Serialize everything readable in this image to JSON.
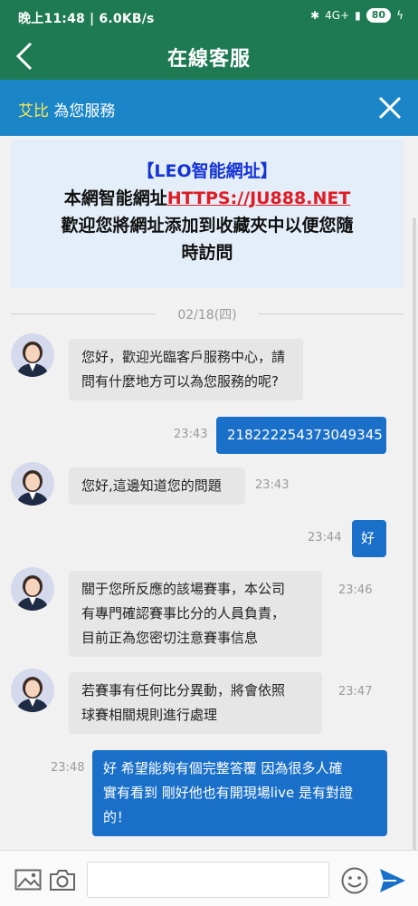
{
  "status_bar": {
    "left": "晚上11:48 | 6.0KB/s",
    "network": "4G+",
    "battery": "80"
  },
  "header": {
    "title": "在線客服"
  },
  "agent_bar": {
    "name": "艾比",
    "suffix": " 為您服務"
  },
  "notice": {
    "line1": "【LEO智能網址】",
    "line2_prefix": "本網智能網址",
    "line2_url": "HTTPS://JU888.NET",
    "line3": "歡迎您將網址添加到收藏夾中以便您隨",
    "line4": "時訪問"
  },
  "date_separator": "02/18(四)",
  "messages": [
    {
      "dir": "in",
      "lines": [
        "您好，歡迎光臨客戶服務中心，請",
        "問有什麼地方可以為您服務的呢?"
      ],
      "time": ""
    },
    {
      "dir": "out",
      "lines": [
        "218222254373049345"
      ],
      "time": "23:43"
    },
    {
      "dir": "in",
      "lines": [
        "您好,這邊知道您的問題"
      ],
      "time": "23:43"
    },
    {
      "dir": "out",
      "lines": [
        "好"
      ],
      "time": "23:44"
    },
    {
      "dir": "in",
      "lines": [
        "關于您所反應的該場賽事，本公司",
        "有專門確認賽事比分的人員負責，",
        "目前正為您密切注意賽事信息"
      ],
      "time": "23:46"
    },
    {
      "dir": "in",
      "lines": [
        "若賽事有任何比分異動，將會依照",
        "球賽相關規則進行處理"
      ],
      "time": "23:47"
    },
    {
      "dir": "out",
      "lines": [
        "好 希望能夠有個完整答覆 因為很多人確",
        "實有看到 剛好他也有開現場live 是有對證",
        "的！"
      ],
      "time": "23:48"
    }
  ],
  "input": {
    "placeholder": ""
  },
  "colors": {
    "header": "#1e7a52",
    "agent_bar": "#1a86c8",
    "out_bubble": "#1a70c9",
    "in_bubble": "#e6e6e6",
    "url": "#e01b24",
    "brand": "#1533d6"
  }
}
